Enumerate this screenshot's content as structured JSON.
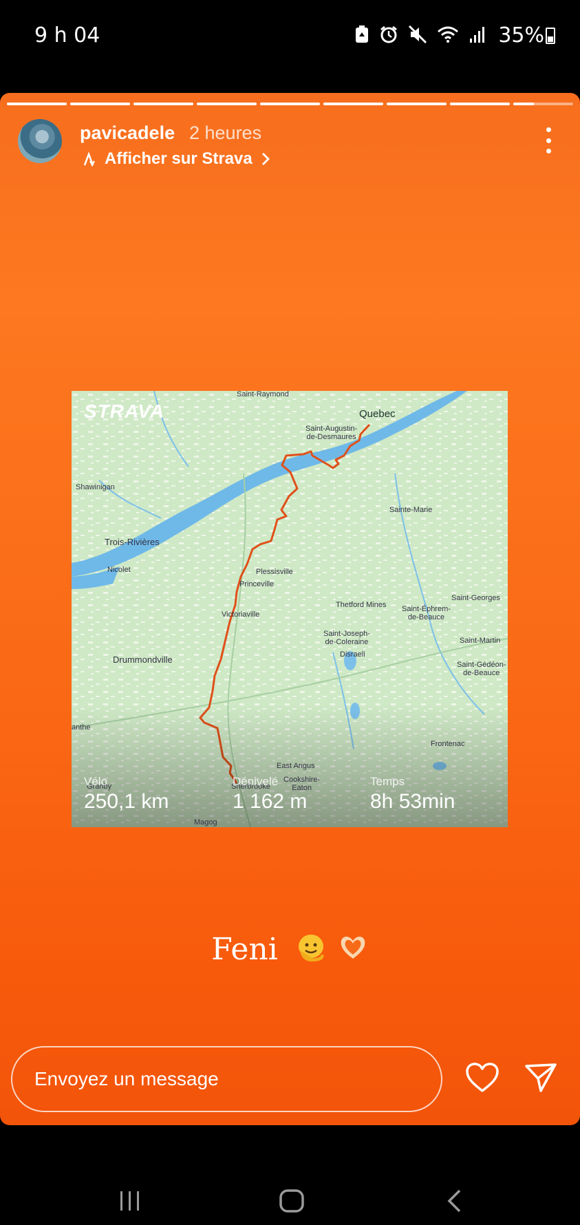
{
  "status_bar": {
    "time": "9 h 04",
    "battery": "35%",
    "icons": [
      "battery-saver-icon",
      "alarm-icon",
      "mute-icon",
      "wifi-icon",
      "signal-icon"
    ]
  },
  "story": {
    "segments_total": 9,
    "current_segment": 9,
    "current_segment_progress": 0.35,
    "username": "pavicadele",
    "time_ago": "2 heures",
    "strava_link": "Afficher sur Strava",
    "caption": "Feni",
    "caption_emojis": [
      "melting-face-emoji",
      "heart-hands-emoji"
    ]
  },
  "strava_card": {
    "logo": "STRAVA",
    "places": {
      "saint_raymond": "Saint-Raymond",
      "quebec": "Quebec",
      "saint_augustin": "Saint-Augustin-\nde-Desmaures",
      "shawinigan": "Shawinigan",
      "sainte_marie": "Sainte-Marie",
      "trois_rivieres": "Trois-Rivières",
      "nicolet": "Nicolet",
      "plessisville": "Plessisville",
      "princeville": "Princeville",
      "victoriaville": "Victoriaville",
      "thetford": "Thetford Mines",
      "saint_ephrem": "Saint-Éphrem-\nde-Beauce",
      "saint_georges": "Saint-Georges",
      "saint_joseph": "Saint-Joseph-\nde-Coleraine",
      "disraeli": "Disraeli",
      "saint_martin": "Saint-Martin",
      "saint_gedeon": "Saint-Gédéon-\nde-Beauce",
      "drummondville": "Drummondville",
      "frontenac": "Frontenac",
      "anthe": "anthe",
      "east_angus": "East Angus",
      "cookshire": "Cookshire-\nEaton",
      "granby": "Granby",
      "sherbrooke": "Sherbrooke",
      "magog": "Magog"
    },
    "stats": [
      {
        "label": "Vélo",
        "value": "250,1 km"
      },
      {
        "label": "Dénivelé",
        "value": "1 162 m"
      },
      {
        "label": "Temps",
        "value": "8h 53min"
      }
    ]
  },
  "composer": {
    "placeholder": "Envoyez un message"
  },
  "nav_bar": {
    "buttons": [
      "recent-apps-icon",
      "home-icon",
      "back-icon"
    ]
  },
  "colors": {
    "story_orange": "#fd7820",
    "map_green": "#c8e6c0",
    "river_blue": "#6fb9e8",
    "route_orange": "#e0501a"
  }
}
